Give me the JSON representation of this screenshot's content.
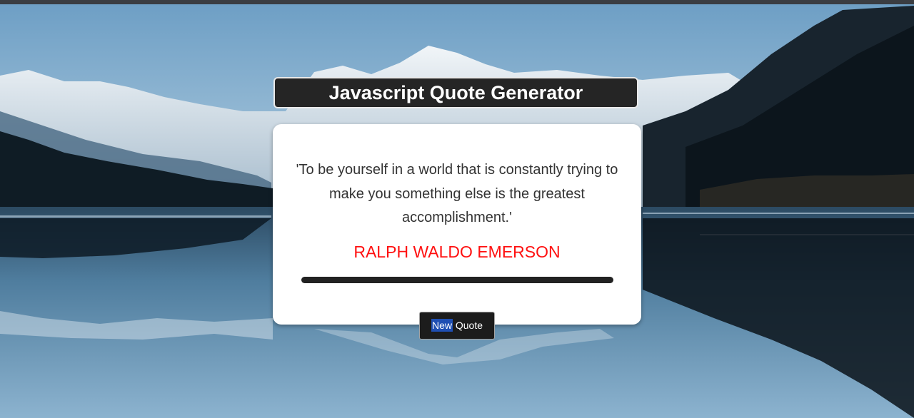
{
  "header": {
    "title": "Javascript Quote Generator"
  },
  "quote": {
    "text": "'To be yourself in a world that is constantly trying to make you something else is the greatest accomplishment.'",
    "author": "RALPH WALDO EMERSON"
  },
  "button": {
    "label_highlighted": "New",
    "label_rest": " Quote"
  },
  "colors": {
    "author": "#ff1010",
    "title_bg": "#252525",
    "button_highlight": "#1f4fb3"
  }
}
